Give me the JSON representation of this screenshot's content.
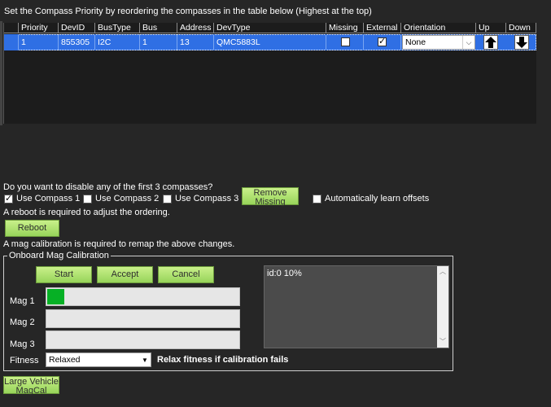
{
  "grid": {
    "title": "Set the Compass Priority by reordering the compasses in the table below (Highest at the top)",
    "headers": {
      "priority": "Priority",
      "devid": "DevID",
      "bustype": "BusType",
      "bus": "Bus",
      "address": "Address",
      "devtype": "DevType",
      "missing": "Missing",
      "external": "External",
      "orientation": "Orientation",
      "up": "Up",
      "down": "Down"
    },
    "rows": [
      {
        "priority": "1",
        "devid": "855305",
        "bustype": "I2C",
        "bus": "1",
        "address": "13",
        "devtype": "QMC5883L",
        "missing": false,
        "external": true,
        "orientation": "None"
      }
    ]
  },
  "options": {
    "disable_question": "Do you want to disable any of the first 3 compasses?",
    "use_compass_1": "Use Compass 1",
    "use_compass_2": "Use Compass 2",
    "use_compass_3": "Use Compass 3",
    "use_compass_1_checked": true,
    "use_compass_2_checked": false,
    "use_compass_3_checked": false,
    "remove_missing_line1": "Remove",
    "remove_missing_line2": "Missing",
    "auto_learn": "Automatically learn offsets",
    "auto_learn_checked": false,
    "reboot_note": "A reboot is required to adjust the ordering.",
    "reboot_label": "Reboot",
    "mag_cal_note": "A mag calibration is required to remap the above changes."
  },
  "onboard": {
    "legend": "Onboard Mag Calibration",
    "start": "Start",
    "accept": "Accept",
    "cancel": "Cancel",
    "mag1_label": "Mag 1",
    "mag2_label": "Mag 2",
    "mag3_label": "Mag 3",
    "mag1_progress": 0.09,
    "mag2_progress": 0,
    "mag3_progress": 0,
    "fitness_label": "Fitness",
    "fitness_value": "Relaxed",
    "relax_label": "Relax fitness if calibration fails",
    "log_text": "id:0 10%"
  },
  "large_vehicle": {
    "line1": "Large Vehicle",
    "line2": "MagCal"
  },
  "colors": {
    "background": "#262626",
    "selection": "#2f6fe4",
    "button": "#b3e271",
    "progress": "#06b025"
  }
}
